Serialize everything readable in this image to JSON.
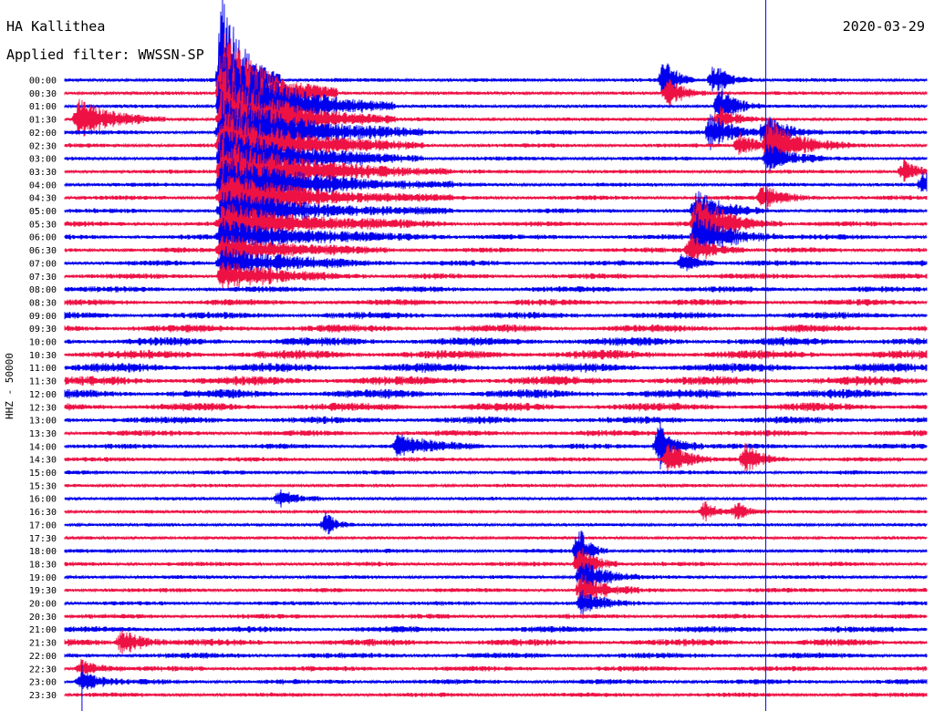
{
  "header": {
    "station": "HA Kallithea",
    "date": "2020-03-29",
    "filter_label": "Applied filter: WWSSN-SP",
    "channel_label": "HHZ - 50000"
  },
  "colors": {
    "even_trace": "#0000ee",
    "odd_trace": "#ee1144",
    "marker": "#0000ee"
  },
  "chart_data": {
    "type": "line",
    "title": "HA Kallithea",
    "subtitle": "Applied filter: WWSSN-SP",
    "ylabel": "HHZ - 50000",
    "rows": [
      "00:00",
      "00:30",
      "01:00",
      "01:30",
      "02:00",
      "02:30",
      "03:00",
      "03:30",
      "04:00",
      "04:30",
      "05:00",
      "05:30",
      "06:00",
      "06:30",
      "07:00",
      "07:30",
      "08:00",
      "08:30",
      "09:00",
      "09:30",
      "10:00",
      "10:30",
      "11:00",
      "11:30",
      "12:00",
      "12:30",
      "13:00",
      "13:30",
      "14:00",
      "14:30",
      "15:00",
      "15:30",
      "16:00",
      "16:30",
      "17:00",
      "17:30",
      "18:00",
      "18:30",
      "19:00",
      "19:30",
      "20:00",
      "20:30",
      "21:00",
      "21:30",
      "22:00",
      "22:30",
      "23:00",
      "23:30"
    ],
    "row_minutes": 30,
    "noise_level": [
      0.25,
      0.2,
      0.2,
      0.25,
      0.35,
      0.3,
      0.3,
      0.3,
      0.3,
      0.35,
      0.4,
      0.45,
      0.45,
      0.45,
      0.5,
      0.5,
      0.55,
      0.6,
      0.7,
      0.8,
      0.9,
      1.0,
      1.0,
      1.0,
      1.0,
      0.9,
      0.7,
      0.55,
      0.45,
      0.35,
      0.3,
      0.2,
      0.2,
      0.2,
      0.15,
      0.15,
      0.3,
      0.35,
      0.25,
      0.35,
      0.3,
      0.4,
      0.6,
      0.7,
      0.55,
      0.45,
      0.45,
      0.35
    ],
    "events": [
      {
        "row": 3,
        "minute": 0.5,
        "amplitude": 2.5,
        "duration": 3
      },
      {
        "row": 0,
        "minute": 5.5,
        "amplitude": 12,
        "duration": 2
      },
      {
        "row": 1,
        "minute": 5.5,
        "amplitude": 8,
        "duration": 4
      },
      {
        "row": 2,
        "minute": 5.5,
        "amplitude": 7,
        "duration": 6
      },
      {
        "row": 3,
        "minute": 5.5,
        "amplitude": 6,
        "duration": 6
      },
      {
        "row": 4,
        "minute": 5.5,
        "amplitude": 5,
        "duration": 7
      },
      {
        "row": 5,
        "minute": 5.5,
        "amplitude": 4.5,
        "duration": 7
      },
      {
        "row": 6,
        "minute": 5.5,
        "amplitude": 4,
        "duration": 7
      },
      {
        "row": 7,
        "minute": 5.5,
        "amplitude": 4,
        "duration": 8
      },
      {
        "row": 8,
        "minute": 5.5,
        "amplitude": 3.5,
        "duration": 8
      },
      {
        "row": 9,
        "minute": 5.5,
        "amplitude": 3,
        "duration": 8
      },
      {
        "row": 10,
        "minute": 5.5,
        "amplitude": 2.5,
        "duration": 8
      },
      {
        "row": 11,
        "minute": 5.5,
        "amplitude": 2.5,
        "duration": 8
      },
      {
        "row": 12,
        "minute": 5.5,
        "amplitude": 2,
        "duration": 8
      },
      {
        "row": 13,
        "minute": 5.5,
        "amplitude": 2,
        "duration": 6
      },
      {
        "row": 14,
        "minute": 5.5,
        "amplitude": 2,
        "duration": 6
      },
      {
        "row": 15,
        "minute": 5.5,
        "amplitude": 1.8,
        "duration": 5
      },
      {
        "row": 0,
        "minute": 20.9,
        "amplitude": 3,
        "duration": 1
      },
      {
        "row": 1,
        "minute": 21,
        "amplitude": 2,
        "duration": 1.5
      },
      {
        "row": 4,
        "minute": 22.5,
        "amplitude": 2.2,
        "duration": 2
      },
      {
        "row": 5,
        "minute": 23.5,
        "amplitude": 1.5,
        "duration": 2
      },
      {
        "row": 7,
        "minute": 29.2,
        "amplitude": 1.5,
        "duration": 1.5
      },
      {
        "row": 9,
        "minute": 24.3,
        "amplitude": 1.5,
        "duration": 2
      },
      {
        "row": 10,
        "minute": 22,
        "amplitude": 2.5,
        "duration": 2.5
      },
      {
        "row": 11,
        "minute": 22,
        "amplitude": 3.5,
        "duration": 3
      },
      {
        "row": 12,
        "minute": 22,
        "amplitude": 3,
        "duration": 3
      },
      {
        "row": 13,
        "minute": 21.8,
        "amplitude": 2,
        "duration": 2
      },
      {
        "row": 14,
        "minute": 21.5,
        "amplitude": 1.2,
        "duration": 1.5
      },
      {
        "row": 28,
        "minute": 11.6,
        "amplitude": 1.5,
        "duration": 3
      },
      {
        "row": 32,
        "minute": 7.5,
        "amplitude": 1.2,
        "duration": 1.5
      },
      {
        "row": 34,
        "minute": 9.1,
        "amplitude": 1.5,
        "duration": 1
      },
      {
        "row": 28,
        "minute": 20.7,
        "amplitude": 3,
        "duration": 1.5
      },
      {
        "row": 29,
        "minute": 21,
        "amplitude": 2.5,
        "duration": 1.5
      },
      {
        "row": 29,
        "minute": 23.7,
        "amplitude": 2,
        "duration": 1.5
      },
      {
        "row": 33,
        "minute": 22.3,
        "amplitude": 1.5,
        "duration": 1
      },
      {
        "row": 33,
        "minute": 23.4,
        "amplitude": 1.2,
        "duration": 1
      },
      {
        "row": 36,
        "minute": 17.9,
        "amplitude": 3,
        "duration": 1
      },
      {
        "row": 37,
        "minute": 17.9,
        "amplitude": 2.5,
        "duration": 1.5
      },
      {
        "row": 38,
        "minute": 18,
        "amplitude": 2.5,
        "duration": 2
      },
      {
        "row": 39,
        "minute": 18,
        "amplitude": 2,
        "duration": 2
      },
      {
        "row": 40,
        "minute": 18,
        "amplitude": 1.5,
        "duration": 2
      },
      {
        "row": 43,
        "minute": 2,
        "amplitude": 1.5,
        "duration": 2
      },
      {
        "row": 45,
        "minute": 0.6,
        "amplitude": 1.2,
        "duration": 1.5
      },
      {
        "row": 46,
        "minute": 0.6,
        "amplitude": 1.5,
        "duration": 1.5
      },
      {
        "row": 0,
        "minute": 22.6,
        "amplitude": 2,
        "duration": 1.5
      },
      {
        "row": 2,
        "minute": 22.8,
        "amplitude": 2.5,
        "duration": 1.5
      },
      {
        "row": 3,
        "minute": 22.8,
        "amplitude": 1.5,
        "duration": 1.5
      },
      {
        "row": 4,
        "minute": 24.4,
        "amplitude": 2.5,
        "duration": 2
      },
      {
        "row": 5,
        "minute": 24.5,
        "amplitude": 3,
        "duration": 3
      },
      {
        "row": 6,
        "minute": 24.5,
        "amplitude": 2,
        "duration": 2
      },
      {
        "row": 8,
        "minute": 29.9,
        "amplitude": 2,
        "duration": 1
      }
    ],
    "marker_minutes": [
      0.6,
      24.4
    ]
  }
}
